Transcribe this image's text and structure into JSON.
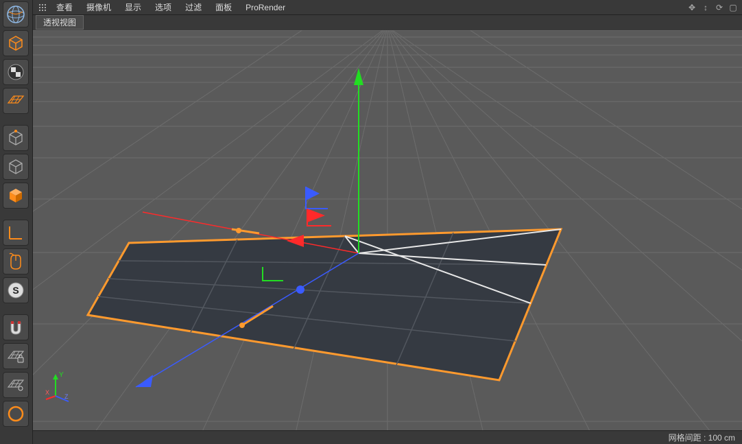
{
  "menu": {
    "items": [
      "查看",
      "摄像机",
      "显示",
      "选项",
      "过滤",
      "面板",
      "ProRender"
    ]
  },
  "view_label": "透视视图",
  "status": {
    "grid_spacing": "网格间距 : 100 cm"
  },
  "mini_axis": {
    "x": "X",
    "y": "Y",
    "z": "Z"
  },
  "toolbar_icons": [
    "globe-icon",
    "cube-solid-icon",
    "checker-sphere-icon",
    "plane-grid-icon",
    "cube-point-icon",
    "cube-wire-icon",
    "cube-shaded-icon",
    "axis-icon",
    "mouse-icon",
    "s-sphere-icon",
    "magnet-icon",
    "plane-lock-icon",
    "plane-grid2-icon",
    "ring-icon"
  ],
  "colors": {
    "accent": "#ff8c1a",
    "axis_x": "#ff2a2a",
    "axis_y": "#22dd22",
    "axis_z": "#3a5bff"
  }
}
